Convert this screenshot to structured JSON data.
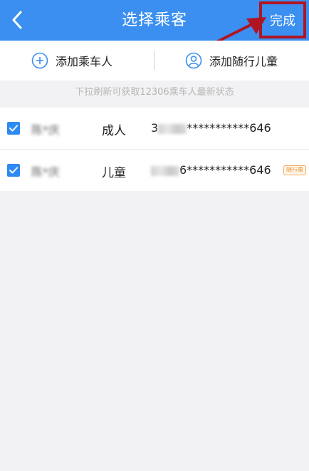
{
  "header": {
    "title": "选择乘客",
    "done_label": "完成"
  },
  "add_bar": {
    "add_passenger_label": "添加乘车人",
    "add_child_label": "添加随行儿童"
  },
  "hint": "下拉刷新可获取12306乘车人最新状态",
  "passengers": [
    {
      "name": "陈*庆",
      "type": "成人",
      "id_prefix": "3",
      "id_suffix": "***********646",
      "checked": true,
      "badge": ""
    },
    {
      "name": "陈*庆",
      "type": "儿童",
      "id_prefix": "",
      "id_suffix": "6***********646",
      "checked": true,
      "badge": "随行票"
    }
  ],
  "colors": {
    "header": "#3a8ff0",
    "highlight_box": "#b01523",
    "checkbox": "#2d8af2",
    "badge": "#e8902c"
  },
  "icons": {
    "back": "chevron-left-icon",
    "add": "plus-circle-icon",
    "child": "user-circle-icon",
    "check": "check-icon"
  }
}
